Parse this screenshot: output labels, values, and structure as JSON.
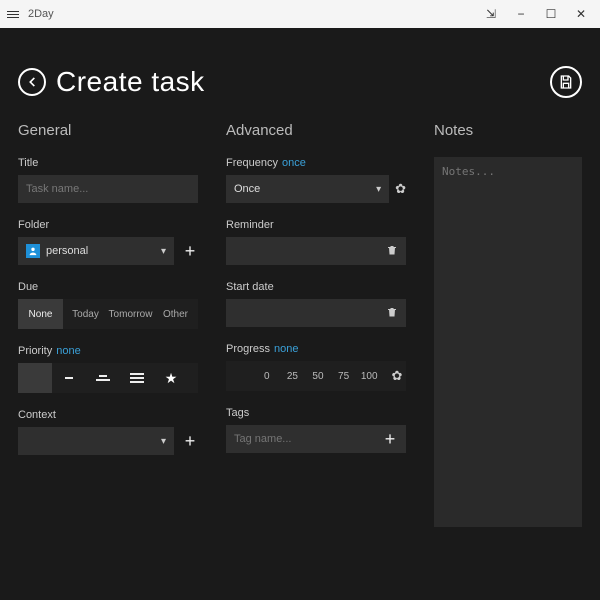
{
  "app": {
    "name": "2Day"
  },
  "header": {
    "title": "Create task"
  },
  "general": {
    "heading": "General",
    "title_label": "Title",
    "title_placeholder": "Task name...",
    "folder_label": "Folder",
    "folder_value": "personal",
    "due_label": "Due",
    "due_options": [
      "None",
      "Today",
      "Tomorrow",
      "Other"
    ],
    "due_selected": "None",
    "priority_label": "Priority",
    "priority_sub": "none",
    "context_label": "Context"
  },
  "advanced": {
    "heading": "Advanced",
    "frequency_label": "Frequency",
    "frequency_sub": "once",
    "frequency_value": "Once",
    "reminder_label": "Reminder",
    "startdate_label": "Start date",
    "progress_label": "Progress",
    "progress_sub": "none",
    "progress_values": [
      "0",
      "25",
      "50",
      "75",
      "100"
    ],
    "tags_label": "Tags",
    "tags_placeholder": "Tag name..."
  },
  "notes": {
    "heading": "Notes",
    "placeholder": "Notes..."
  }
}
